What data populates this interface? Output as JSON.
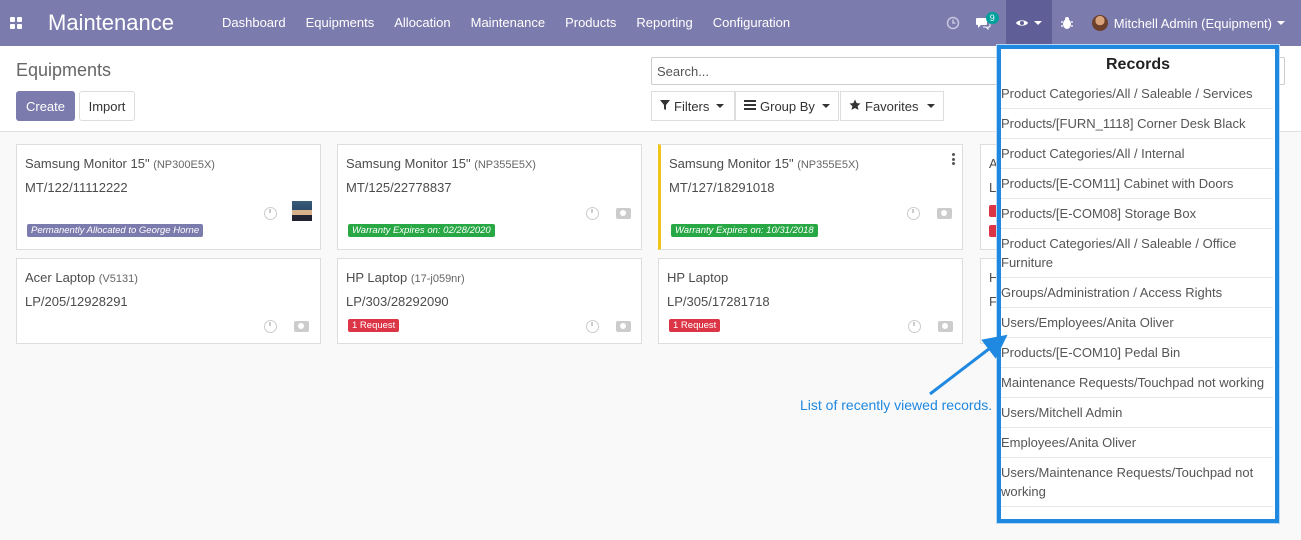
{
  "navbar": {
    "app_title": "Maintenance",
    "menu": [
      "Dashboard",
      "Equipments",
      "Allocation",
      "Maintenance",
      "Products",
      "Reporting",
      "Configuration"
    ],
    "messages_count": "9",
    "user_name": "Mitchell Admin (Equipment)",
    "bg_color": "#7c7bad"
  },
  "control": {
    "page_title": "Equipments",
    "create_label": "Create",
    "import_label": "Import",
    "search_placeholder": "Search...",
    "filters_label": "Filters",
    "group_by_label": "Group By",
    "favorites_label": "Favorites"
  },
  "cards": [
    {
      "name": "Samsung Monitor 15\"",
      "model": "(NP300E5X)",
      "serial": "MT/122/11112222",
      "tag": "Permanently Allocated to George Horne",
      "tag_color": "purple"
    },
    {
      "name": "Samsung Monitor 15\"",
      "model": "(NP355E5X)",
      "serial": "MT/125/22778837",
      "tag": "Warranty Expires on: 02/28/2020",
      "tag_color": "green"
    },
    {
      "name": "Samsung Monitor 15\"",
      "model": "(NP355E5X)",
      "serial": "MT/127/18291018",
      "tag": "Warranty Expires on: 10/31/2018",
      "tag_color": "green"
    },
    {
      "name": "A",
      "model": "",
      "serial": "L",
      "tag": "",
      "tag_color": "red"
    },
    {
      "name": "Acer Laptop",
      "model": "(V5131)",
      "serial": "LP/205/12928291",
      "tag": "",
      "tag_color": ""
    },
    {
      "name": "HP Laptop",
      "model": "(17-j059nr)",
      "serial": "LP/303/28292090",
      "tag": "1 Request",
      "tag_color": "red"
    },
    {
      "name": "HP Laptop",
      "model": "",
      "serial": "LP/305/17281718",
      "tag": "1 Request",
      "tag_color": "red"
    },
    {
      "name": "H",
      "model": "",
      "serial": "F",
      "tag": "",
      "tag_color": ""
    }
  ],
  "records_dropdown": {
    "header": "Records",
    "items": [
      "Product Categories/All / Saleable / Services",
      "Products/[FURN_1118] Corner Desk Black",
      "Product Categories/All / Internal",
      "Products/[E-COM11] Cabinet with Doors",
      "Products/[E-COM08] Storage Box",
      "Product Categories/All / Saleable / Office Furniture",
      "Groups/Administration / Access Rights",
      "Users/Employees/Anita Oliver",
      "Products/[E-COM10] Pedal Bin",
      "Maintenance Requests/Touchpad not working",
      "Users/Mitchell Admin",
      "Employees/Anita Oliver",
      "Users/Maintenance Requests/Touchpad not working"
    ],
    "highlight_color": "#1f88e0"
  },
  "annotation": {
    "text": "List of recently viewed records."
  }
}
